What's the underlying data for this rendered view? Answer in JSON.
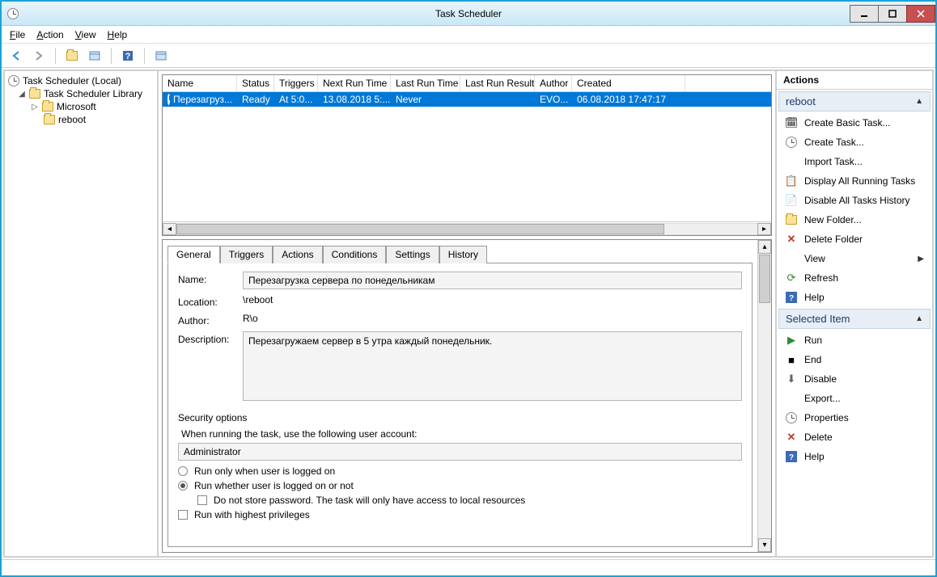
{
  "window": {
    "title": "Task Scheduler"
  },
  "menu": {
    "file": "File",
    "action": "Action",
    "view": "View",
    "help": "Help"
  },
  "tree": {
    "root": "Task Scheduler (Local)",
    "lib": "Task Scheduler Library",
    "microsoft": "Microsoft",
    "reboot": "reboot"
  },
  "columns": {
    "name": "Name",
    "status": "Status",
    "triggers": "Triggers",
    "next": "Next Run Time",
    "last": "Last Run Time",
    "result": "Last Run Result",
    "author": "Author",
    "created": "Created"
  },
  "row": {
    "name": "Перезагруз...",
    "status": "Ready",
    "triggers": "At 5:0...",
    "next": "13.08.2018 5:...",
    "last": "Never",
    "result": "",
    "author": "EVO...",
    "created": "06.08.2018 17:47:17"
  },
  "tabs": {
    "general": "General",
    "triggers": "Triggers",
    "actions": "Actions",
    "conditions": "Conditions",
    "settings": "Settings",
    "history": "History"
  },
  "general": {
    "name_label": "Name:",
    "name_value": "Перезагрузка сервера по понедельникам",
    "location_label": "Location:",
    "location_value": "\\reboot",
    "author_label": "Author:",
    "author_value": "R\\o",
    "desc_label": "Description:",
    "desc_value": "Перезагружаем сервер в 5 утра каждый понедельник.",
    "sec_title": "Security options",
    "sec_sub": "When running the task, use the following user account:",
    "account": "Administrator",
    "radio1": "Run only when user is logged on",
    "radio2": "Run whether user is logged on or not",
    "nostore": "Do not store password.  The task will only have access to local resources",
    "highest": "Run with highest privileges"
  },
  "actions": {
    "title": "Actions",
    "hdr1": "reboot",
    "create_basic": "Create Basic Task...",
    "create": "Create Task...",
    "import": "Import Task...",
    "display": "Display All Running Tasks",
    "disable_hist": "Disable All Tasks History",
    "new_folder": "New Folder...",
    "delete_folder": "Delete Folder",
    "view": "View",
    "refresh": "Refresh",
    "help": "Help",
    "hdr2": "Selected Item",
    "run": "Run",
    "end": "End",
    "disable": "Disable",
    "export": "Export...",
    "properties": "Properties",
    "delete": "Delete",
    "help2": "Help"
  }
}
